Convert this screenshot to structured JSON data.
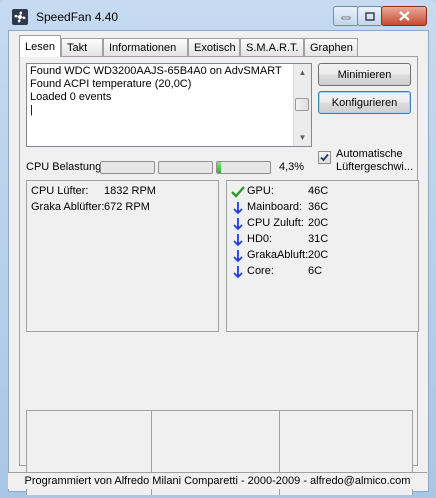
{
  "window": {
    "title": "SpeedFan 4.40",
    "minimize_icon": "minimize-icon",
    "maximize_icon": "maximize-icon",
    "close_icon": "close-icon"
  },
  "tabs": [
    {
      "label": "Lesen",
      "active": true
    },
    {
      "label": "Takt"
    },
    {
      "label": "Informationen"
    },
    {
      "label": "Exotisch"
    },
    {
      "label": "S.M.A.R.T."
    },
    {
      "label": "Graphen"
    }
  ],
  "log": {
    "lines": [
      "Found WDC WD3200AAJS-65B4A0 on AdvSMART",
      "Found ACPI temperature (20,0C)",
      "Loaded 0 events",
      "|"
    ]
  },
  "buttons": {
    "minimize": "Minimieren",
    "configure": "Konfigurieren"
  },
  "auto_fan": {
    "label": "Automatische Lüftergeschwi...",
    "checked": true
  },
  "cpu_usage": {
    "label": "CPU Belastung",
    "bars": [
      0.0,
      0.0,
      0.08
    ],
    "percent_text": "4,3%"
  },
  "fans": [
    {
      "name": "CPU Lüfter:",
      "value": "1832 RPM"
    },
    {
      "name": "Graka Ablüfter:",
      "value": "672 RPM"
    }
  ],
  "temps": [
    {
      "icon": "checkmark-icon",
      "name": "GPU:",
      "value": "46C"
    },
    {
      "icon": "arrow-down-icon",
      "name": "Mainboard:",
      "value": "36C"
    },
    {
      "icon": "arrow-down-icon",
      "name": "CPU Zuluft:",
      "value": "20C"
    },
    {
      "icon": "arrow-down-icon",
      "name": "HD0:",
      "value": "31C"
    },
    {
      "icon": "arrow-down-icon",
      "name": "GrakaAbluft:",
      "value": "20C"
    },
    {
      "icon": "arrow-down-icon",
      "name": "Core:",
      "value": "6C"
    }
  ],
  "footer": "Programmiert von Alfredo Milani Comparetti - 2000-2009 - alfredo@almico.com",
  "colors": {
    "check_green": "#2e9a2e",
    "arrow_blue": "#1c3fd8",
    "bar_fill": "#2fb12f"
  }
}
